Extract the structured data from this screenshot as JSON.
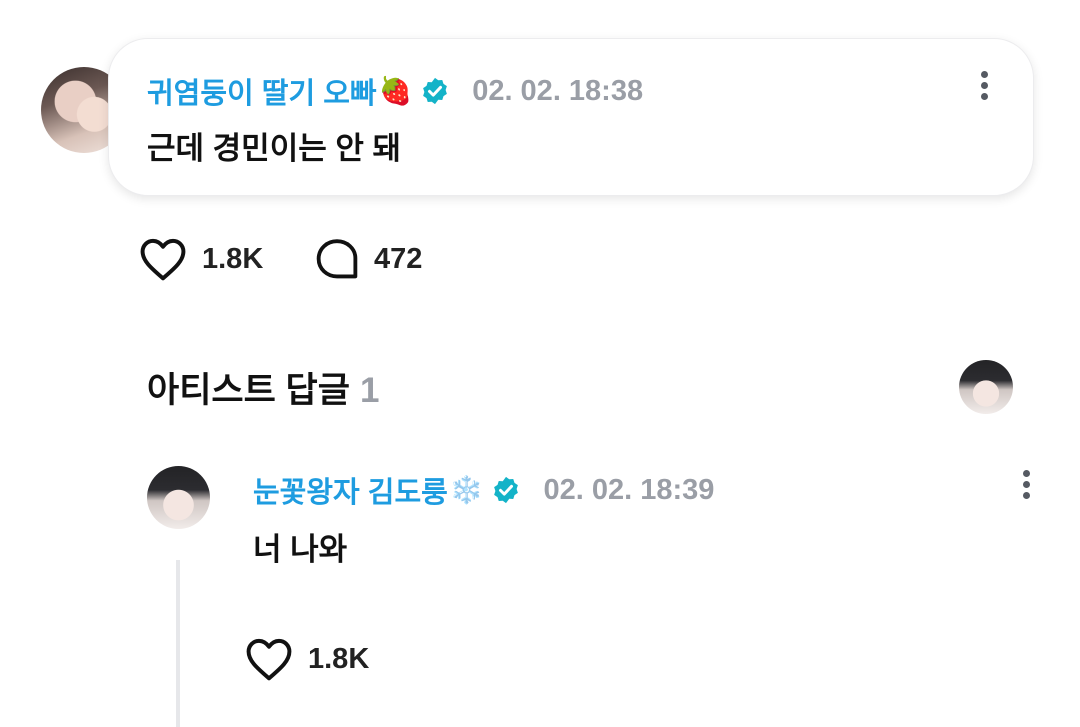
{
  "comment": {
    "author": "귀염둥이 딸기 오빠",
    "author_emoji": "🍓",
    "timestamp": "02. 02. 18:38",
    "text": "근데 경민이는 안 돼",
    "likes": "1.8K",
    "replies": "472"
  },
  "artist_section": {
    "title": "아티스트 답글",
    "count": "1"
  },
  "artist_reply": {
    "author": "눈꽃왕자 김도룽",
    "author_emoji": "❄️",
    "timestamp": "02. 02. 18:39",
    "text": "너 나와",
    "likes": "1.8K"
  },
  "colors": {
    "name_blue": "#1e9ce0",
    "verified_teal": "#14b3c8",
    "timestamp_gray": "#9a9ea6"
  },
  "icons": {
    "verified": "verified-badge-icon",
    "like": "heart-icon",
    "reply": "speech-bubble-icon",
    "more": "more-vertical-icon"
  }
}
